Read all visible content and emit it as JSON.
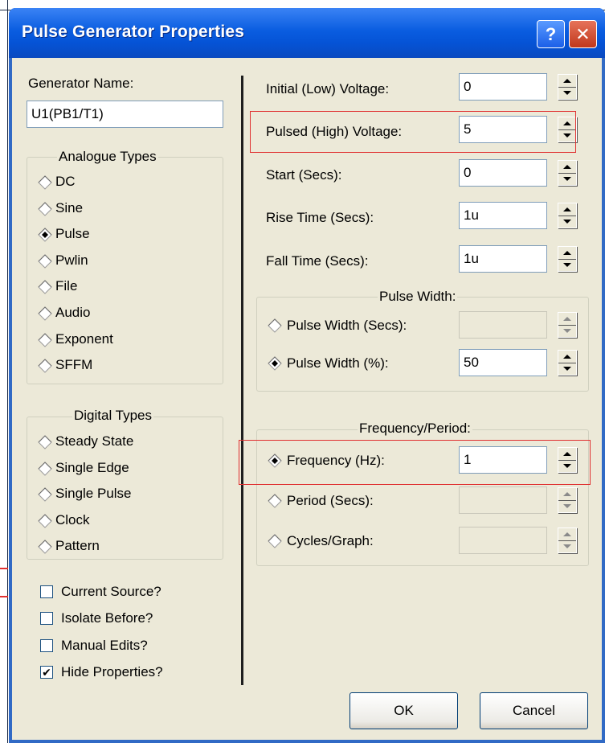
{
  "window": {
    "title": "Pulse Generator Properties",
    "help_label": "?",
    "close_label": "✕"
  },
  "left": {
    "generator_name_label": "Generator Name:",
    "generator_name_value": "U1(PB1/T1)",
    "analogue": {
      "title": "Analogue Types",
      "items": [
        {
          "label": "DC",
          "selected": false
        },
        {
          "label": "Sine",
          "selected": false
        },
        {
          "label": "Pulse",
          "selected": true
        },
        {
          "label": "Pwlin",
          "selected": false
        },
        {
          "label": "File",
          "selected": false
        },
        {
          "label": "Audio",
          "selected": false
        },
        {
          "label": "Exponent",
          "selected": false
        },
        {
          "label": "SFFM",
          "selected": false
        }
      ]
    },
    "digital": {
      "title": "Digital Types",
      "items": [
        {
          "label": "Steady State"
        },
        {
          "label": "Single Edge"
        },
        {
          "label": "Single Pulse"
        },
        {
          "label": "Clock"
        },
        {
          "label": "Pattern"
        }
      ]
    },
    "checkboxes": [
      {
        "label": "Current Source?",
        "checked": false
      },
      {
        "label": "Isolate Before?",
        "checked": false
      },
      {
        "label": "Manual Edits?",
        "checked": false
      },
      {
        "label": "Hide Properties?",
        "checked": true
      }
    ]
  },
  "right": {
    "fields": [
      {
        "label": "Initial (Low) Voltage:",
        "value": "0"
      },
      {
        "label": "Pulsed (High) Voltage:",
        "value": "5"
      },
      {
        "label": "Start (Secs):",
        "value": "0"
      },
      {
        "label": "Rise Time (Secs):",
        "value": "1u"
      },
      {
        "label": "Fall Time (Secs):",
        "value": "1u"
      }
    ],
    "pulse_width": {
      "title": "Pulse Width:",
      "options": [
        {
          "label": "Pulse Width (Secs):",
          "value": "",
          "selected": false
        },
        {
          "label": "Pulse Width (%):",
          "value": "50",
          "selected": true
        }
      ]
    },
    "frequency": {
      "title": "Frequency/Period:",
      "options": [
        {
          "label": "Frequency (Hz):",
          "value": "1",
          "selected": true
        },
        {
          "label": "Period (Secs):",
          "value": "",
          "selected": false
        },
        {
          "label": "Cycles/Graph:",
          "value": "",
          "selected": false
        }
      ]
    }
  },
  "buttons": {
    "ok": "OK",
    "cancel": "Cancel"
  },
  "colors": {
    "titlebar": "#0553d6",
    "dialog_bg": "#ece9d8",
    "highlight": "#e03030"
  }
}
